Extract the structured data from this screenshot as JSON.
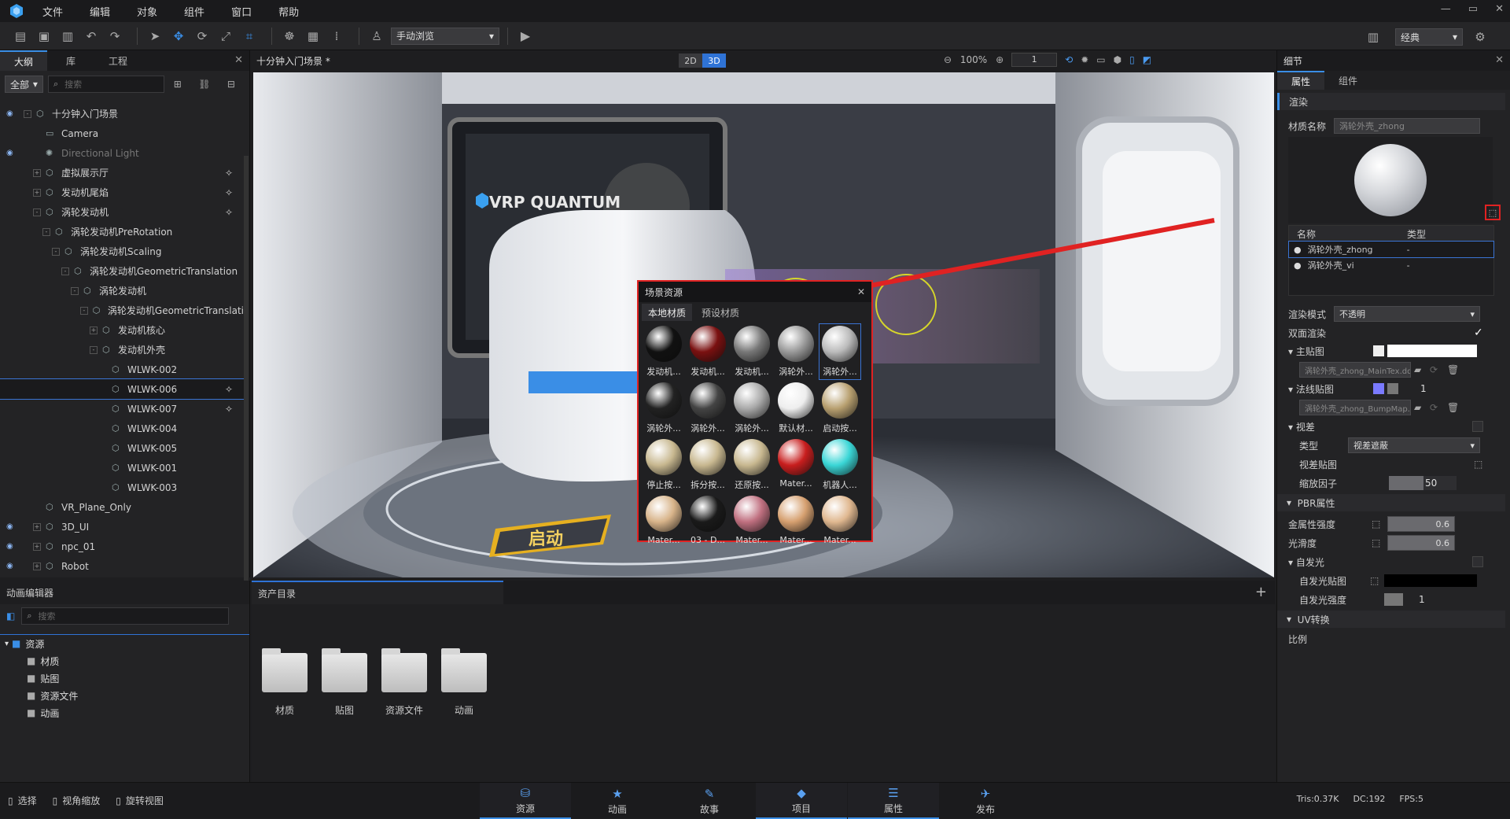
{
  "menu": [
    "文件",
    "编辑",
    "对象",
    "组件",
    "窗口",
    "帮助"
  ],
  "window_controls": [
    "—",
    "▭",
    "✕"
  ],
  "toolbar": {
    "view_mode": "手动浏览",
    "layout": "经典"
  },
  "left_panel": {
    "tabs": [
      "大纲",
      "库",
      "工程"
    ],
    "filter": "全部",
    "search_placeholder": "搜索",
    "tree": [
      {
        "label": "十分钟入门场景",
        "indent": 0,
        "eye": true,
        "exp": "-",
        "icon": "node"
      },
      {
        "label": "Camera",
        "indent": 1,
        "icon": "camera"
      },
      {
        "label": "Directional Light",
        "indent": 1,
        "icon": "light",
        "dim": true,
        "eye": true
      },
      {
        "label": "虚拟展示厅",
        "indent": 1,
        "exp": "+",
        "icon": "node",
        "ricon": true
      },
      {
        "label": "发动机尾焰",
        "indent": 1,
        "exp": "+",
        "icon": "node",
        "ricon": true
      },
      {
        "label": "涡轮发动机",
        "indent": 1,
        "exp": "-",
        "icon": "node",
        "ricon": true
      },
      {
        "label": "涡轮发动机PreRotation",
        "indent": 2,
        "exp": "-",
        "icon": "node"
      },
      {
        "label": "涡轮发动机Scaling",
        "indent": 3,
        "exp": "-",
        "icon": "node"
      },
      {
        "label": "涡轮发动机GeometricTranslation",
        "indent": 4,
        "exp": "-",
        "icon": "node"
      },
      {
        "label": "涡轮发动机",
        "indent": 5,
        "exp": "-",
        "icon": "node"
      },
      {
        "label": "涡轮发动机GeometricTranslati",
        "indent": 6,
        "exp": "-",
        "icon": "node"
      },
      {
        "label": "发动机核心",
        "indent": 7,
        "exp": "+",
        "icon": "node"
      },
      {
        "label": "发动机外壳",
        "indent": 7,
        "exp": "-",
        "icon": "node"
      },
      {
        "label": "WLWK-002",
        "indent": 8,
        "icon": "mesh"
      },
      {
        "label": "WLWK-006",
        "indent": 8,
        "icon": "mesh",
        "sel": true,
        "ricon": true
      },
      {
        "label": "WLWK-007",
        "indent": 8,
        "icon": "mesh",
        "ricon": true
      },
      {
        "label": "WLWK-004",
        "indent": 8,
        "icon": "mesh"
      },
      {
        "label": "WLWK-005",
        "indent": 8,
        "icon": "mesh"
      },
      {
        "label": "WLWK-001",
        "indent": 8,
        "icon": "mesh"
      },
      {
        "label": "WLWK-003",
        "indent": 8,
        "icon": "mesh"
      },
      {
        "label": "VR_Plane_Only",
        "indent": 1,
        "icon": "node"
      },
      {
        "label": "3D_UI",
        "indent": 1,
        "exp": "+",
        "icon": "node",
        "eye": true
      },
      {
        "label": "npc_01",
        "indent": 1,
        "exp": "+",
        "icon": "node",
        "eye": true
      },
      {
        "label": "Robot",
        "indent": 1,
        "exp": "+",
        "icon": "node",
        "eye": true
      }
    ]
  },
  "viewport": {
    "title": "十分钟入门场景 *",
    "mode_2d": "2D",
    "mode_3d": "3D",
    "zoom": "100%",
    "frame": "1",
    "screen_text": "VRP QUANTUM",
    "button_text": "启动"
  },
  "popup": {
    "title": "场景资源",
    "tabs": [
      "本地材质",
      "预设材质"
    ],
    "materials": [
      {
        "label": "发动机...",
        "color": "#111"
      },
      {
        "label": "发动机...",
        "color": "#7a1010"
      },
      {
        "label": "发动机...",
        "color": "#777"
      },
      {
        "label": "涡轮外...",
        "color": "#999"
      },
      {
        "label": "涡轮外...",
        "color": "#bbb",
        "sel": true
      },
      {
        "label": "涡轮外...",
        "color": "#222"
      },
      {
        "label": "涡轮外...",
        "color": "#444"
      },
      {
        "label": "涡轮外...",
        "color": "#aaa"
      },
      {
        "label": "默认材...",
        "color": "#eee"
      },
      {
        "label": "启动按...",
        "color": "#b8a070"
      },
      {
        "label": "停止按...",
        "color": "#c8b890"
      },
      {
        "label": "拆分按...",
        "color": "#c8b890"
      },
      {
        "label": "还原按...",
        "color": "#c8b890"
      },
      {
        "label": "Mater...",
        "color": "#c81e1e"
      },
      {
        "label": "机器人...",
        "color": "#3ad6d6"
      },
      {
        "label": "Mater...",
        "color": "#d8b48a"
      },
      {
        "label": "03 - D...",
        "color": "#1a1a1a"
      },
      {
        "label": "Mater...",
        "color": "#c07080"
      },
      {
        "label": "Mater...",
        "color": "#d6a070"
      },
      {
        "label": "Mater...",
        "color": "#e0b890"
      }
    ]
  },
  "right_panel": {
    "title": "细节",
    "tabs": [
      "属性",
      "组件"
    ],
    "render_section": "渲染",
    "material_name_label": "材质名称",
    "material_name_value": "涡轮外壳_zhong",
    "table_headers": [
      "名称",
      "类型"
    ],
    "materials": [
      {
        "name": "涡轮外壳_zhong",
        "type": "-"
      },
      {
        "name": "涡轮外壳_vi",
        "type": "-"
      }
    ],
    "render_mode_label": "渲染模式",
    "render_mode_value": "不透明",
    "double_sided_label": "双面渲染",
    "main_tex_label": "主贴图",
    "main_tex_value": "涡轮外壳_zhong_MainTex.dds",
    "normal_label": "法线贴图",
    "normal_value": "1",
    "normal_tex_value": "涡轮外壳_zhong_BumpMap.d",
    "parallax_label": "视差",
    "type_label": "类型",
    "type_value": "视差遮蔽",
    "parallax_tex_label": "视差贴图",
    "scale_label": "缩放因子",
    "scale_value": "50",
    "pbr_section": "PBR属性",
    "metal_label": "金属性强度",
    "metal_value": "0.6",
    "smooth_label": "光滑度",
    "smooth_value": "0.6",
    "emissive_label": "自发光",
    "emissive_tex_label": "自发光贴图",
    "emissive_intensity_label": "自发光强度",
    "emissive_intensity_value": "1",
    "uv_section": "UV转换",
    "ratio_label": "比例"
  },
  "bottom": {
    "anim_editor": "动画编辑器",
    "asset_dir": "资产目录",
    "search_placeholder": "搜索",
    "tree_root": "资源",
    "tree_items": [
      "材质",
      "贴图",
      "资源文件",
      "动画"
    ],
    "folders": [
      "材质",
      "贴图",
      "资源文件",
      "动画"
    ]
  },
  "status": {
    "modes": [
      "选择",
      "视角缩放",
      "旋转视图"
    ],
    "nav": [
      {
        "label": "资源",
        "icon": "⛁"
      },
      {
        "label": "动画",
        "icon": "★"
      },
      {
        "label": "故事",
        "icon": "✎"
      },
      {
        "label": "项目",
        "icon": "◆"
      },
      {
        "label": "属性",
        "icon": "☰"
      },
      {
        "label": "发布",
        "icon": "✈"
      }
    ],
    "tris": "Tris:0.37K",
    "dc": "DC:192",
    "fps": "FPS:5"
  },
  "colors": {
    "accent": "#3a8ee6",
    "highlight": "#e02222"
  }
}
